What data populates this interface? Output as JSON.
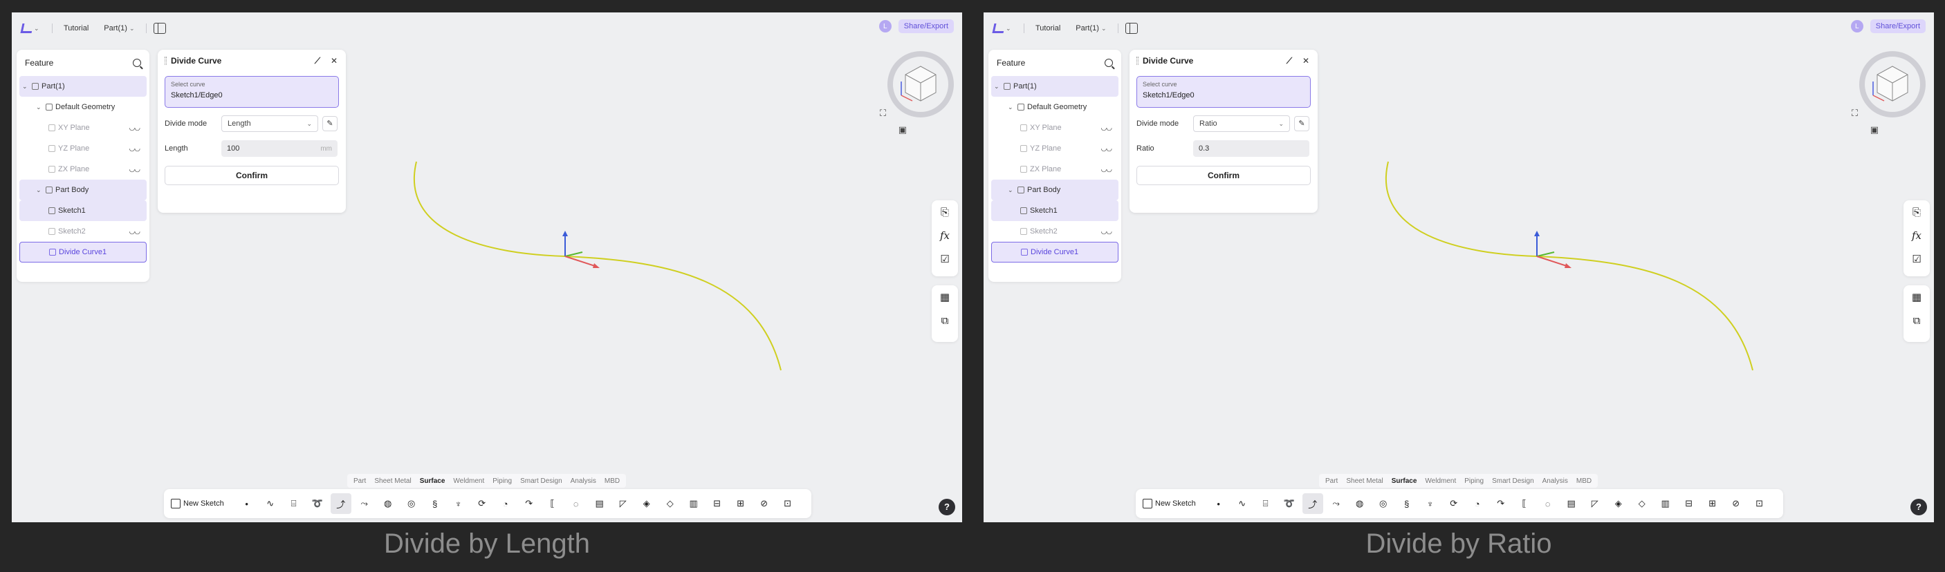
{
  "panels": [
    {
      "caption": "Divide by Length",
      "topbar": {
        "tutorial": "Tutorial",
        "part": "Part(1)",
        "user_initial": "L",
        "share": "Share/Export"
      },
      "feature": {
        "title": "Feature",
        "tree": [
          {
            "label": "Part(1)"
          },
          {
            "label": "Default Geometry"
          },
          {
            "label": "XY Plane"
          },
          {
            "label": "YZ Plane"
          },
          {
            "label": "ZX Plane"
          },
          {
            "label": "Part Body"
          },
          {
            "label": "Sketch1"
          },
          {
            "label": "Sketch2"
          },
          {
            "label": "Divide Curve1"
          }
        ]
      },
      "dialog": {
        "title": "Divide Curve",
        "select_label": "Select curve",
        "select_value": "Sketch1/Edge0",
        "mode_label": "Divide mode",
        "mode_value": "Length",
        "param_label": "Length",
        "param_value": "100",
        "param_unit": "mm",
        "confirm": "Confirm"
      },
      "cat_tabs": [
        "Part",
        "Sheet Metal",
        "Surface",
        "Weldment",
        "Piping",
        "Smart Design",
        "Analysis",
        "MBD"
      ],
      "active_tab": "Surface",
      "new_sketch": "New Sketch",
      "help": "?"
    },
    {
      "caption": "Divide by Ratio",
      "topbar": {
        "tutorial": "Tutorial",
        "part": "Part(1)",
        "user_initial": "L",
        "share": "Share/Export"
      },
      "feature": {
        "title": "Feature",
        "tree": [
          {
            "label": "Part(1)"
          },
          {
            "label": "Default Geometry"
          },
          {
            "label": "XY Plane"
          },
          {
            "label": "YZ Plane"
          },
          {
            "label": "ZX Plane"
          },
          {
            "label": "Part Body"
          },
          {
            "label": "Sketch1"
          },
          {
            "label": "Sketch2"
          },
          {
            "label": "Divide Curve1"
          }
        ]
      },
      "dialog": {
        "title": "Divide Curve",
        "select_label": "Select curve",
        "select_value": "Sketch1/Edge0",
        "mode_label": "Divide mode",
        "mode_value": "Ratio",
        "param_label": "Ratio",
        "param_value": "0.3",
        "param_unit": "",
        "confirm": "Confirm"
      },
      "cat_tabs": [
        "Part",
        "Sheet Metal",
        "Surface",
        "Weldment",
        "Piping",
        "Smart Design",
        "Analysis",
        "MBD"
      ],
      "active_tab": "Surface",
      "new_sketch": "New Sketch",
      "help": "?"
    }
  ],
  "colors": {
    "accent": "#6b5be5",
    "curve": "#d2d21e",
    "canvas": "#eeeff1",
    "background": "#262626"
  }
}
